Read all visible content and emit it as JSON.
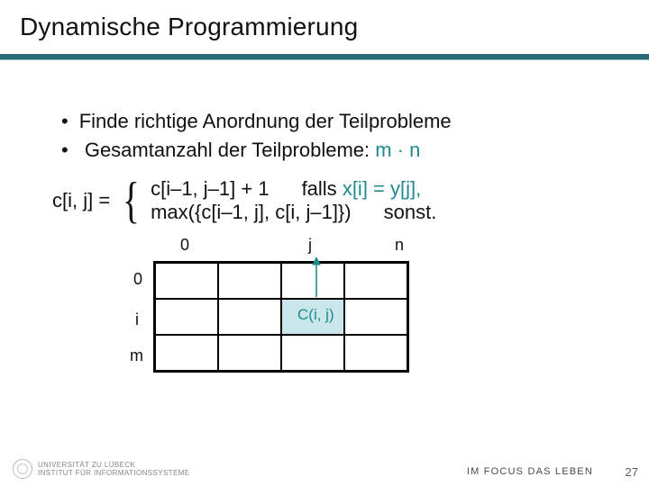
{
  "title": "Dynamische Programmierung",
  "bullets": [
    "Finde richtige Anordnung der Teilprobleme",
    "Gesamtanzahl der Teilprobleme: "
  ],
  "complexity": "m · n",
  "formula": {
    "lhs": "c[i, j] =",
    "case1_expr": "c[i–1, j–1] + 1",
    "case1_cond_prefix": "falls ",
    "case1_cond_cond": "x[i] = y[j],",
    "case2_expr": "max({c[i–1, j], c[i, j–1]})",
    "case2_cond": "sonst."
  },
  "grid": {
    "x_labels": {
      "start": "0",
      "mid": "j",
      "end": "n"
    },
    "y_labels": {
      "start": "0",
      "mid": "i",
      "end": "m"
    },
    "cell_label": "C(i, j)"
  },
  "footer": {
    "org1": "UNIVERSITÄT ZU LÜBECK",
    "org2": "INSTITUT FÜR INFORMATIONSSYSTEME",
    "motto": "IM FOCUS DAS LEBEN",
    "page": "27"
  }
}
